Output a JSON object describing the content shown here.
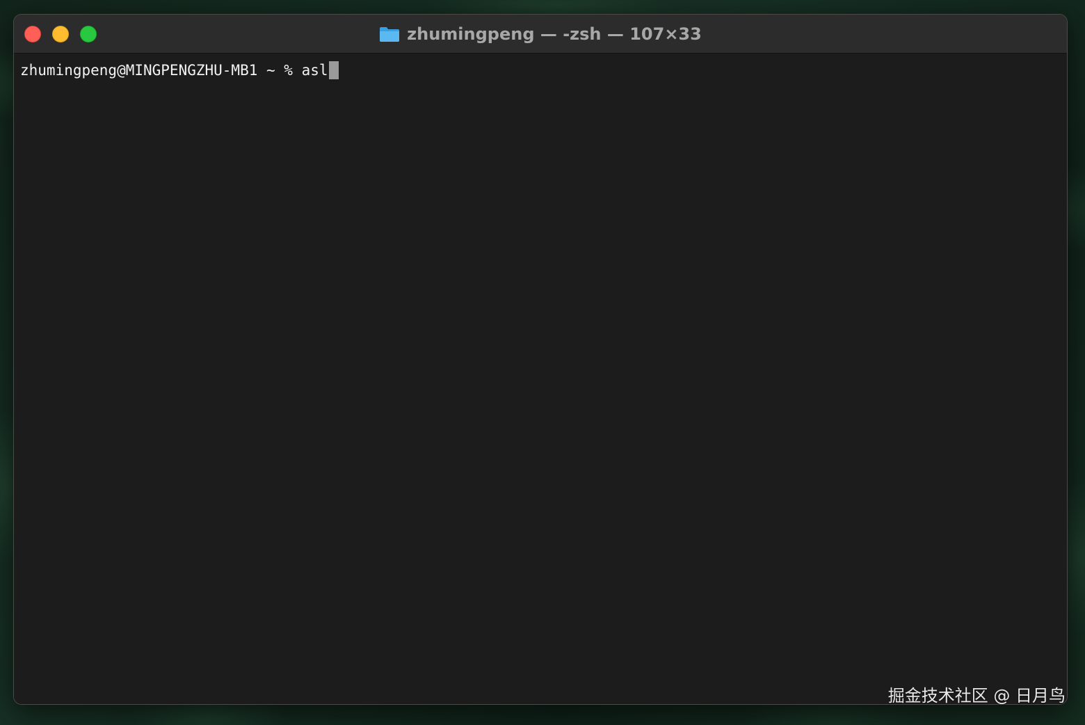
{
  "window": {
    "title": "zhumingpeng — -zsh — 107×33",
    "title_icon": "folder-icon"
  },
  "traffic_lights": {
    "close_color": "#ff5f57",
    "minimize_color": "#febc2e",
    "zoom_color": "#28c840"
  },
  "terminal": {
    "prompt": "zhumingpeng@MINGPENGZHU-MB1 ~ % ",
    "command": "asl"
  },
  "watermark": "掘金技术社区 @ 日月鸟"
}
